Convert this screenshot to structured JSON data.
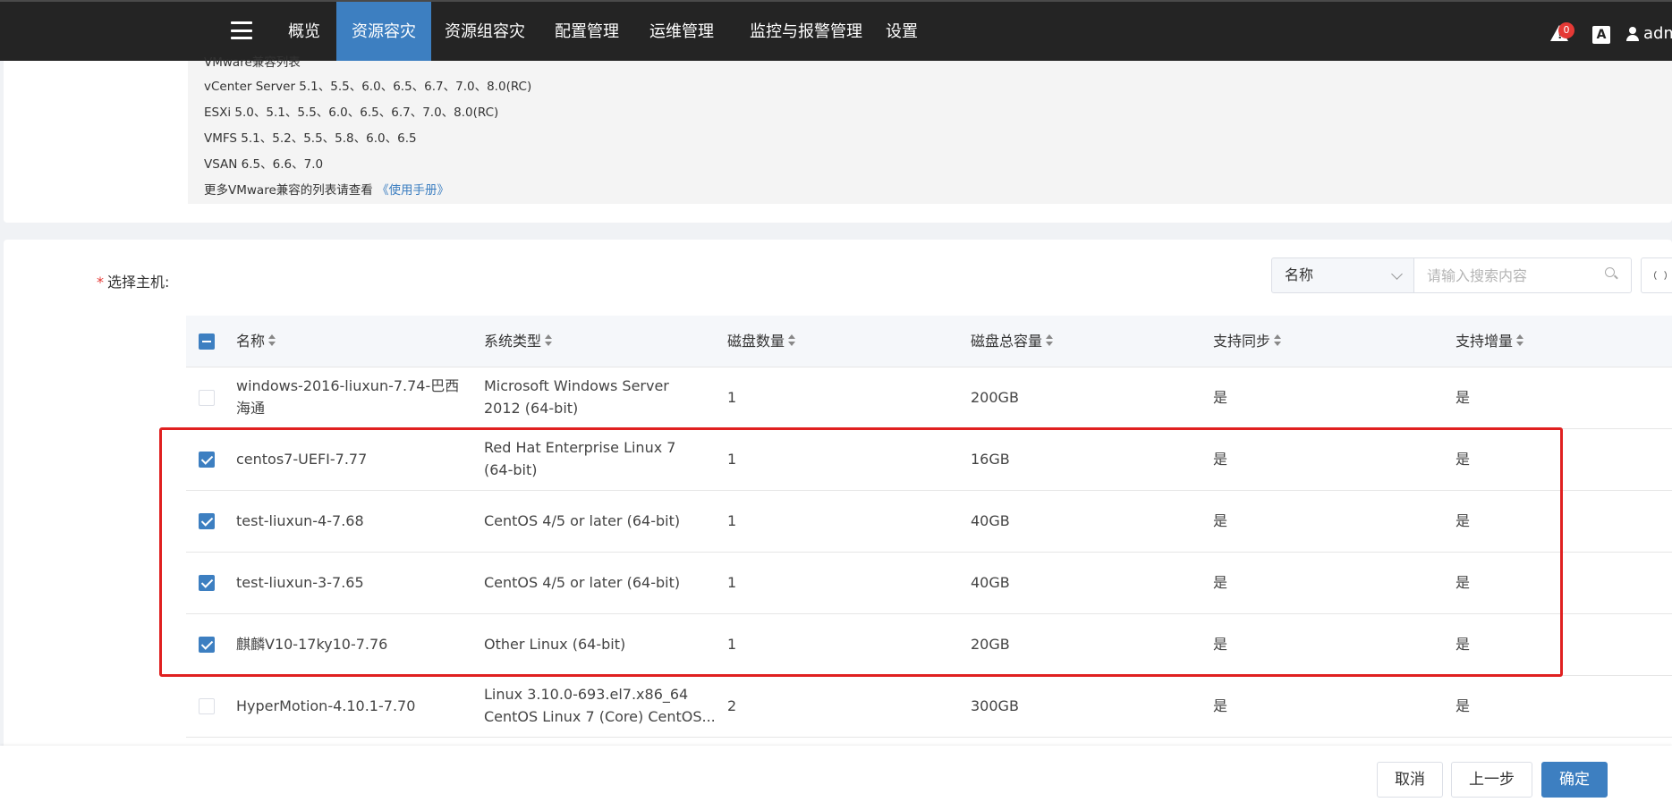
{
  "nav": {
    "items": [
      {
        "label": "概览"
      },
      {
        "label": "资源容灾"
      },
      {
        "label": "资源组容灾"
      },
      {
        "label": "配置管理"
      },
      {
        "label": "运维管理"
      },
      {
        "label": "监控与报警管理"
      },
      {
        "label": "设置"
      }
    ],
    "active_index": 1,
    "alert_count": "0",
    "lang_icon_text": "A",
    "user_name": "adm"
  },
  "compat": {
    "cut_line": "VMware兼容列表",
    "lines": [
      "vCenter Server 5.1、5.5、6.0、6.5、6.7、7.0、8.0(RC)",
      "ESXi 5.0、5.1、5.5、6.0、6.5、6.7、7.0、8.0(RC)",
      "VMFS 5.1、5.2、5.5、5.8、6.0、6.5",
      "VSAN 6.5、6.6、7.0"
    ],
    "more_text": "更多VMware兼容的列表请查看",
    "more_link": "《使用手册》"
  },
  "host_select": {
    "required_mark": "*",
    "label": "选择主机:",
    "search_field": "名称",
    "search_placeholder": "请输入搜索内容"
  },
  "table": {
    "columns": [
      "名称",
      "系统类型",
      "磁盘数量",
      "磁盘总容量",
      "支持同步",
      "支持增量"
    ],
    "rows": [
      {
        "name": "windows-2016-liuxun-7.74-巴西海通",
        "os": "Microsoft Windows Server 2012 (64-bit)",
        "disks": "1",
        "capacity": "200GB",
        "sync": "是",
        "incremental": "是",
        "checked": false
      },
      {
        "name": "centos7-UEFI-7.77",
        "os": "Red Hat Enterprise Linux 7 (64-bit)",
        "disks": "1",
        "capacity": "16GB",
        "sync": "是",
        "incremental": "是",
        "checked": true
      },
      {
        "name": "test-liuxun-4-7.68",
        "os": "CentOS 4/5 or later (64-bit)",
        "disks": "1",
        "capacity": "40GB",
        "sync": "是",
        "incremental": "是",
        "checked": true
      },
      {
        "name": "test-liuxun-3-7.65",
        "os": "CentOS 4/5 or later (64-bit)",
        "disks": "1",
        "capacity": "40GB",
        "sync": "是",
        "incremental": "是",
        "checked": true
      },
      {
        "name": "麒麟V10-17ky10-7.76",
        "os": "Other Linux (64-bit)",
        "disks": "1",
        "capacity": "20GB",
        "sync": "是",
        "incremental": "是",
        "checked": true
      },
      {
        "name": "HyperMotion-4.10.1-7.70",
        "os_line1": "Linux 3.10.0-693.el7.x86_64",
        "os_line2": "CentOS Linux 7 (Core) CentOS...",
        "disks": "2",
        "capacity": "300GB",
        "sync": "是",
        "incremental": "是",
        "checked": false
      }
    ]
  },
  "footer": {
    "cancel": "取消",
    "prev": "上一步",
    "confirm": "确定"
  },
  "colors": {
    "nav_bg": "#242424",
    "nav_active": "#3d7fc1",
    "primary": "#3d7fc1",
    "highlight_box": "#e02020",
    "badge": "#e53935"
  }
}
